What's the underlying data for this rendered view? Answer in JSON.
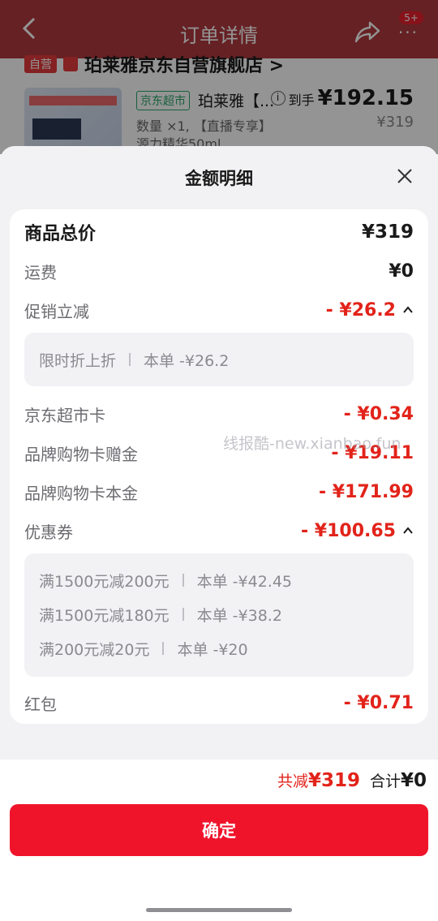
{
  "background": {
    "header_title": "订单详情",
    "badge": "5+",
    "store_tag": "自营",
    "store_name": "珀莱雅京东自营旗舰店 >",
    "product": {
      "channel_tag": "京东超市",
      "name": "珀莱雅【...",
      "price_label": "到手",
      "price": "¥192.15",
      "original_price": "¥319",
      "quantity": "数量 ×1, 【直播专享】",
      "spec": "源力精华50ml"
    }
  },
  "sheet": {
    "title": "金额明细",
    "rows": {
      "goods_total": {
        "label": "商品总价",
        "value": "¥319"
      },
      "shipping": {
        "label": "运费",
        "value": "¥0"
      },
      "promo": {
        "label": "促销立减",
        "value": "- ¥26.2"
      },
      "promo_detail": [
        {
          "name": "限时折上折",
          "amount": "本单 -¥26.2"
        }
      ],
      "jd_card": {
        "label": "京东超市卡",
        "value": "- ¥0.34"
      },
      "brand_gift": {
        "label": "品牌购物卡赠金",
        "value": "- ¥19.11"
      },
      "brand_principal": {
        "label": "品牌购物卡本金",
        "value": "- ¥171.99"
      },
      "coupon": {
        "label": "优惠券",
        "value": "- ¥100.65"
      },
      "coupon_detail": [
        {
          "name": "满1500元减200元",
          "amount": "本单 -¥42.45"
        },
        {
          "name": "满1500元减180元",
          "amount": "本单 -¥38.2"
        },
        {
          "name": "满200元减20元",
          "amount": "本单 -¥20"
        }
      ],
      "red_packet": {
        "label": "红包",
        "value": "- ¥0.71"
      }
    },
    "watermark": "线报酷-new.xianbao.fun"
  },
  "footer": {
    "reduce_label": "共减",
    "reduce_value": "¥319",
    "total_label": "合计",
    "total_value": "¥0",
    "confirm_label": "确定"
  },
  "colors": {
    "accent_red": "#e2231a",
    "button_red": "#f0142b",
    "header_bg": "#b03a3e"
  }
}
